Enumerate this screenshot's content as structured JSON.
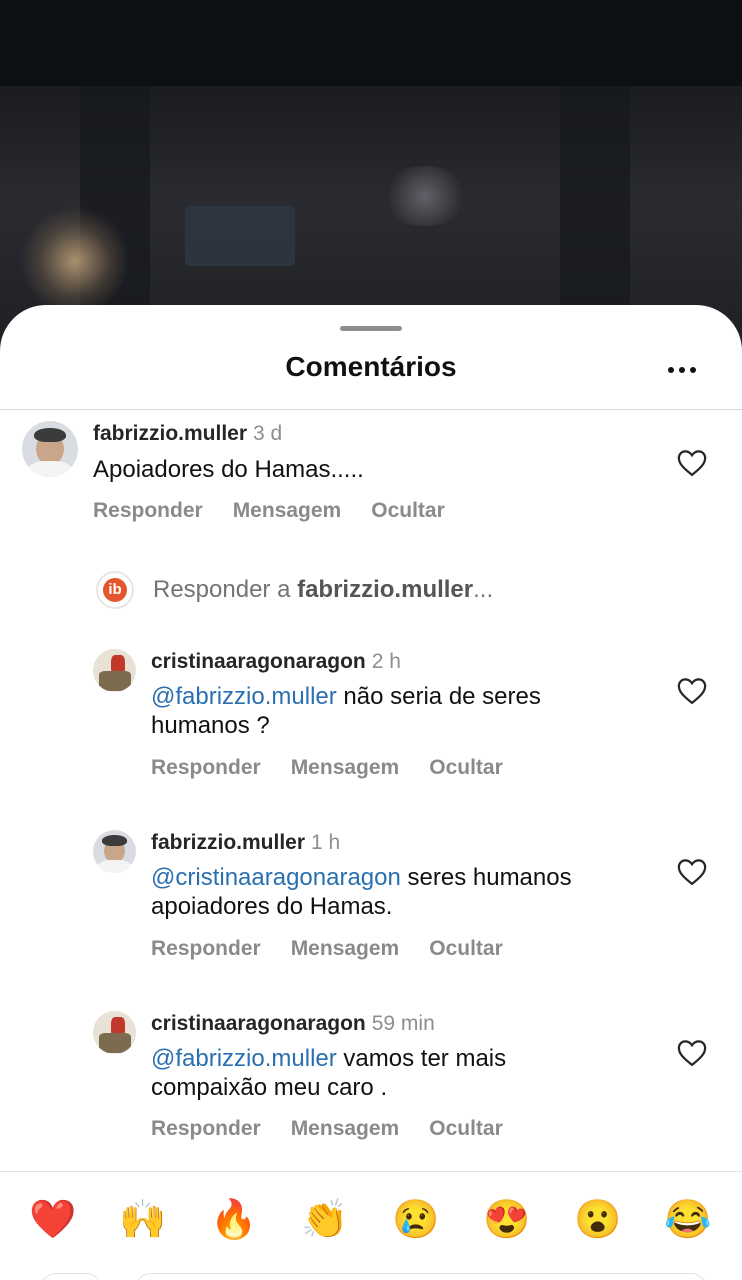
{
  "sheet": {
    "title": "Comentários"
  },
  "comments": [
    {
      "user": "fabrizzio.muller",
      "time": "3 d",
      "mention": "",
      "text": "Apoiadores do Hamas.....",
      "actions": [
        "Responder",
        "Mensagem",
        "Ocultar"
      ]
    },
    {
      "user": "cristinaaragonaragon",
      "time": "2 h",
      "mention": "@fabrizzio.muller",
      "text": " não seria de seres humanos ?",
      "actions": [
        "Responder",
        "Mensagem",
        "Ocultar"
      ]
    },
    {
      "user": "fabrizzio.muller",
      "time": "1 h",
      "mention": "@cristinaaragonaragon",
      "text": " seres humanos apoiadores do Hamas.",
      "actions": [
        "Responder",
        "Mensagem",
        "Ocultar"
      ]
    },
    {
      "user": "cristinaaragonaragon",
      "time": "59 min",
      "mention": "@fabrizzio.muller",
      "text": " vamos ter mais compaixão meu caro .",
      "actions": [
        "Responder",
        "Mensagem",
        "Ocultar"
      ]
    }
  ],
  "reply_prompt": {
    "prefix": "Responder a ",
    "user": "fabrizzio.muller",
    "suffix": "..."
  },
  "reply_logo_text": "ib",
  "emojis": [
    "❤️",
    "🙌",
    "🔥",
    "👏",
    "😢",
    "😍",
    "😮",
    "😂"
  ],
  "colors": {
    "mention": "#2a6fb0",
    "muted": "#8e8e8e",
    "text": "#111111"
  }
}
